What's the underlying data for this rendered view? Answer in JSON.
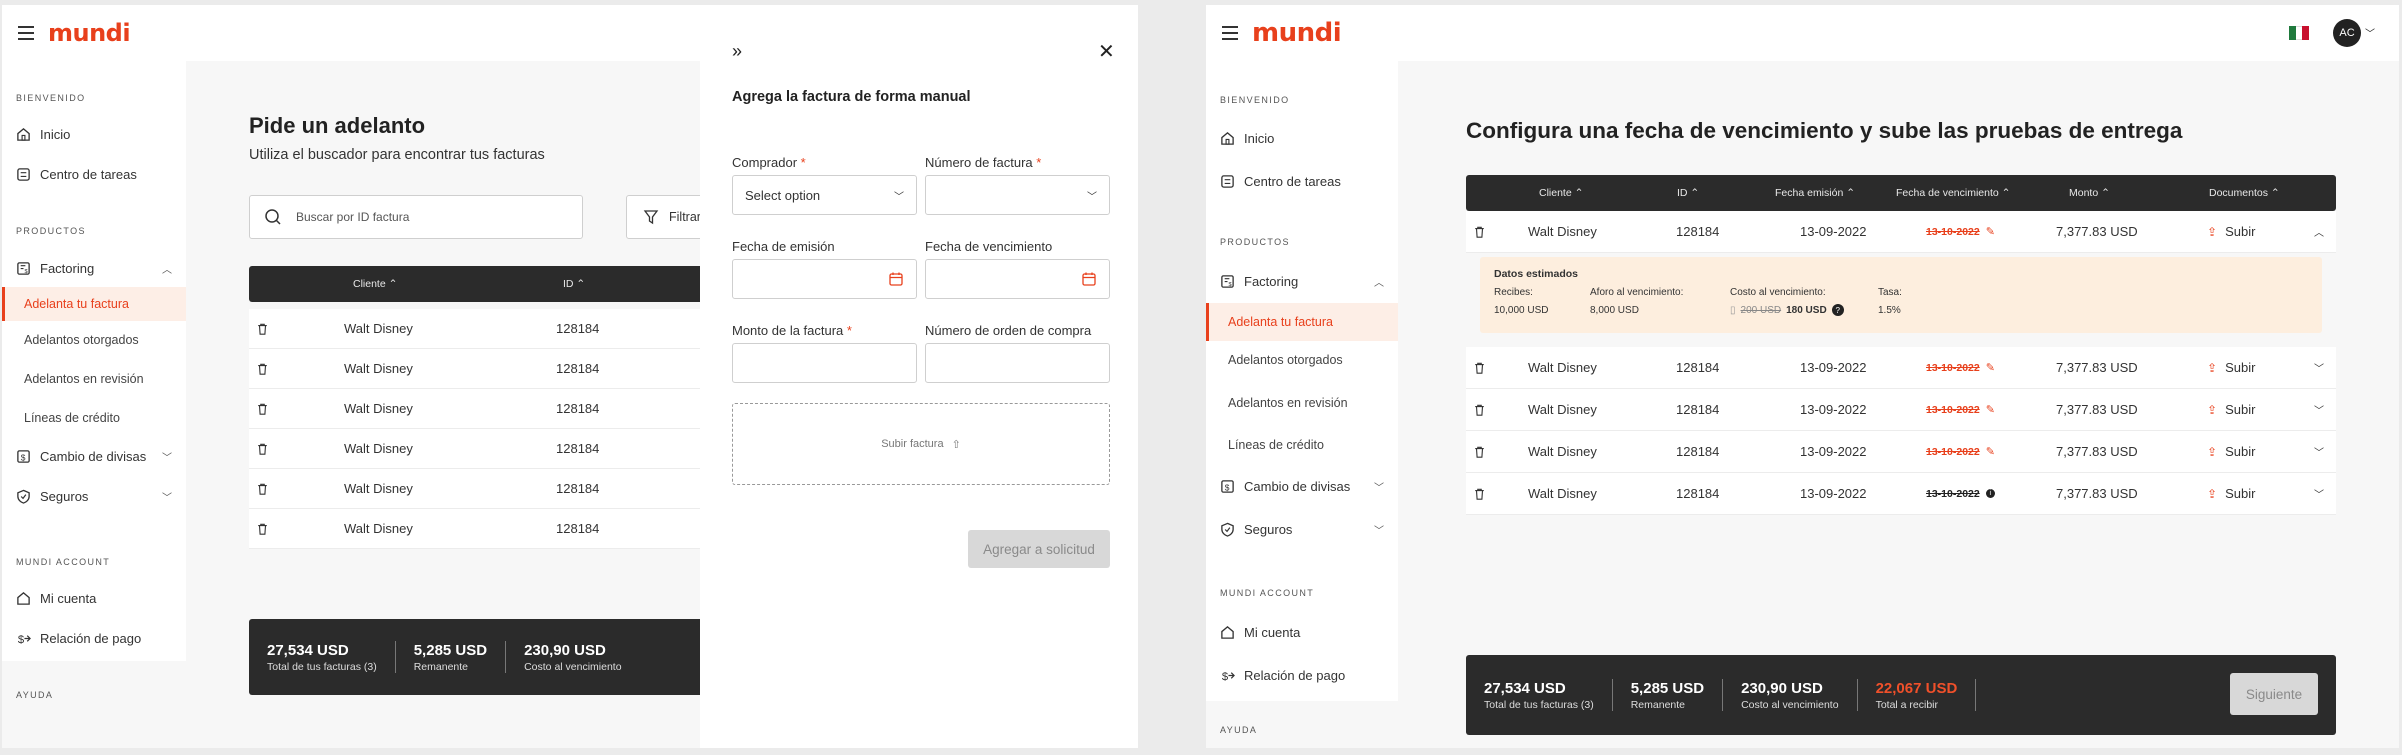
{
  "brand": {
    "logo": "mundi",
    "accent": "#e8401c",
    "dark": "#2b2b2b"
  },
  "sidebar": {
    "welcome": "BIENVENIDO",
    "inicio": "Inicio",
    "tareas": "Centro de tareas",
    "productos": "PRODUCTOS",
    "factoring": "Factoring",
    "adelanta": "Adelanta tu factura",
    "otorgados": "Adelantos otorgados",
    "revision": "Adelantos en revisión",
    "lineas": "Líneas de crédito",
    "divisas": "Cambio de divisas",
    "seguros": "Seguros",
    "account": "MUNDI ACCOUNT",
    "cuenta": "Mi cuenta",
    "relacion": "Relación de pago",
    "ayuda": "AYUDA"
  },
  "screen1": {
    "title": "Pide un adelanto",
    "subtitle": "Utiliza el buscador para encontrar tus facturas",
    "search_placeholder": "Buscar por ID factura",
    "filter_label": "Filtrar",
    "columns": {
      "cliente": "Cliente",
      "id": "ID"
    },
    "rows": [
      {
        "cliente": "Walt Disney",
        "id": "128184"
      },
      {
        "cliente": "Walt Disney",
        "id": "128184"
      },
      {
        "cliente": "Walt Disney",
        "id": "128184"
      },
      {
        "cliente": "Walt Disney",
        "id": "128184"
      },
      {
        "cliente": "Walt Disney",
        "id": "128184"
      },
      {
        "cliente": "Walt Disney",
        "id": "128184"
      }
    ],
    "summary": [
      {
        "value": "27,534 USD",
        "label": "Total de tus facturas (3)"
      },
      {
        "value": "5,285 USD",
        "label": "Remanente"
      },
      {
        "value": "230,90 USD",
        "label": "Costo al vencimiento"
      }
    ]
  },
  "modal": {
    "title": "Agrega la factura de forma manual",
    "comprador_label": "Comprador",
    "comprador_value": "Select option",
    "numero_label": "Número de factura",
    "emision_label": "Fecha de emisión",
    "vencimiento_label": "Fecha de vencimiento",
    "monto_label": "Monto de la factura",
    "orden_label": "Número de orden de compra",
    "upload_label": "Subir factura",
    "submit_label": "Agregar a solicitud",
    "required_mark": "*"
  },
  "screen2": {
    "avatar": "AC",
    "title": "Configura una fecha de vencimiento y sube las pruebas de entrega",
    "columns": {
      "cliente": "Cliente",
      "id": "ID",
      "emision": "Fecha emisión",
      "vencimiento": "Fecha de vencimiento",
      "monto": "Monto",
      "documentos": "Documentos"
    },
    "rows": [
      {
        "cliente": "Walt Disney",
        "id": "128184",
        "emision": "13-09-2022",
        "vencimiento": "13-10-2022",
        "monto": "7,377.83 USD",
        "doc": "Subir"
      },
      {
        "cliente": "Walt Disney",
        "id": "128184",
        "emision": "13-09-2022",
        "vencimiento": "13-10-2022",
        "monto": "7,377.83 USD",
        "doc": "Subir"
      },
      {
        "cliente": "Walt Disney",
        "id": "128184",
        "emision": "13-09-2022",
        "vencimiento": "13-10-2022",
        "monto": "7,377.83 USD",
        "doc": "Subir"
      },
      {
        "cliente": "Walt Disney",
        "id": "128184",
        "emision": "13-09-2022",
        "vencimiento": "13-10-2022",
        "monto": "7,377.83 USD",
        "doc": "Subir"
      },
      {
        "cliente": "Walt Disney",
        "id": "128184",
        "emision": "13-09-2022",
        "vencimiento": "13-10-2022",
        "monto": "7,377.83 USD",
        "doc": "Subir"
      }
    ],
    "details": {
      "title": "Datos estimados",
      "recibes_label": "Recibes:",
      "recibes_value": "10,000 USD",
      "aforo_label": "Aforo al vencimiento:",
      "aforo_value": "8,000 USD",
      "costo_label": "Costo al vencimiento:",
      "costo_old": "200 USD",
      "costo_new": "180 USD",
      "tasa_label": "Tasa:",
      "tasa_value": "1.5%"
    },
    "summary": [
      {
        "value": "27,534 USD",
        "label": "Total de tus facturas (3)"
      },
      {
        "value": "5,285 USD",
        "label": "Remanente"
      },
      {
        "value": "230,90 USD",
        "label": "Costo al vencimiento"
      },
      {
        "value": "22,067 USD",
        "label": "Total a recibir"
      }
    ],
    "next_label": "Siguiente"
  }
}
